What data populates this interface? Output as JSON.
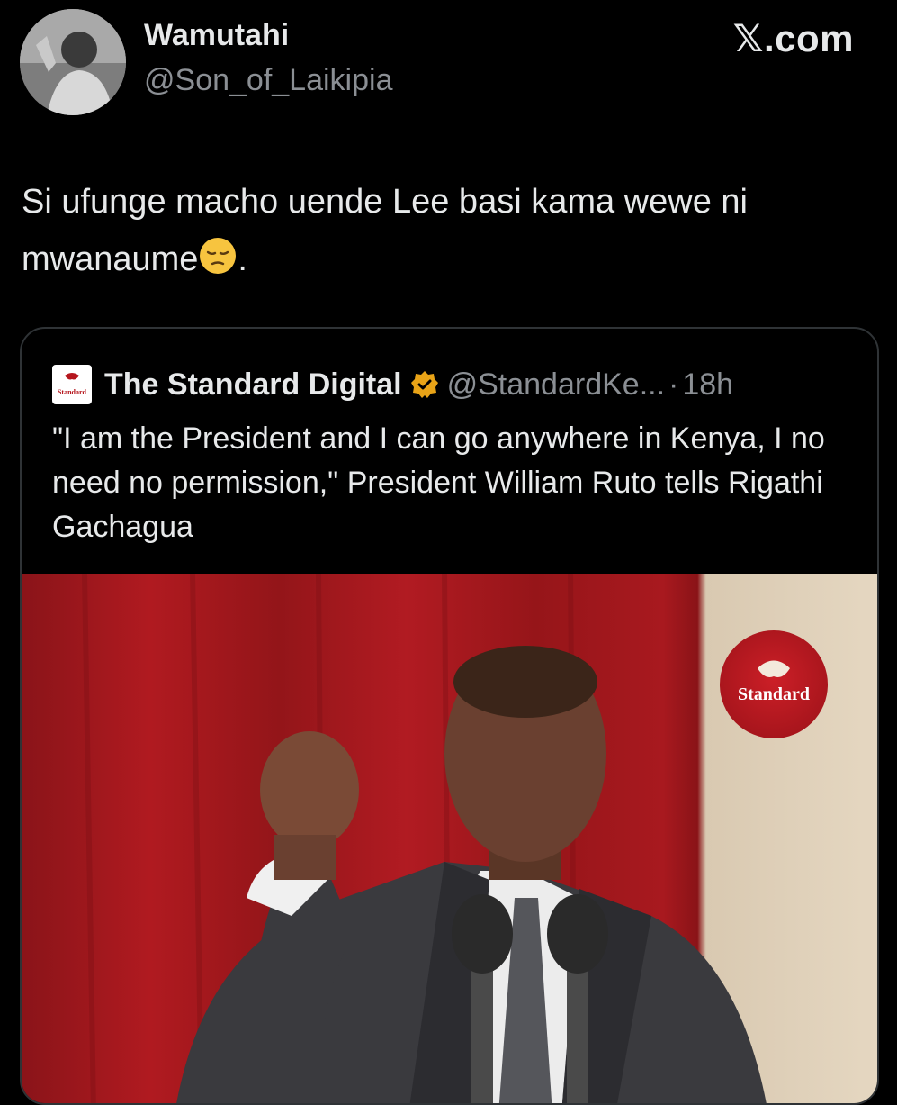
{
  "author": {
    "name": "Wamutahi",
    "handle": "@Son_of_Laikipia"
  },
  "site_label": "𝕏.com",
  "tweet": {
    "text_before_emoji": "Si ufunge macho uende Lee basi kama wewe ni mwanaume",
    "emoji": "pensive-face-emoji",
    "text_after_emoji": "."
  },
  "quoted_tweet": {
    "name": "The Standard Digital",
    "handle": "@StandardKe...",
    "separator": "·",
    "time": "18h",
    "text": "\"I am the President and I can go anywhere in Kenya, I no need no permission,\" President William Ruto tells Rigathi Gachagua",
    "avatar_logo_text": "Standard",
    "media": {
      "watermark_text": "Standard",
      "watermark_color": "#b5161d"
    }
  },
  "colors": {
    "background": "#000000",
    "text": "#e7e9ea",
    "secondary_text": "#8b8f94",
    "border": "#2f3336",
    "verified_badge": "#e8a317"
  }
}
